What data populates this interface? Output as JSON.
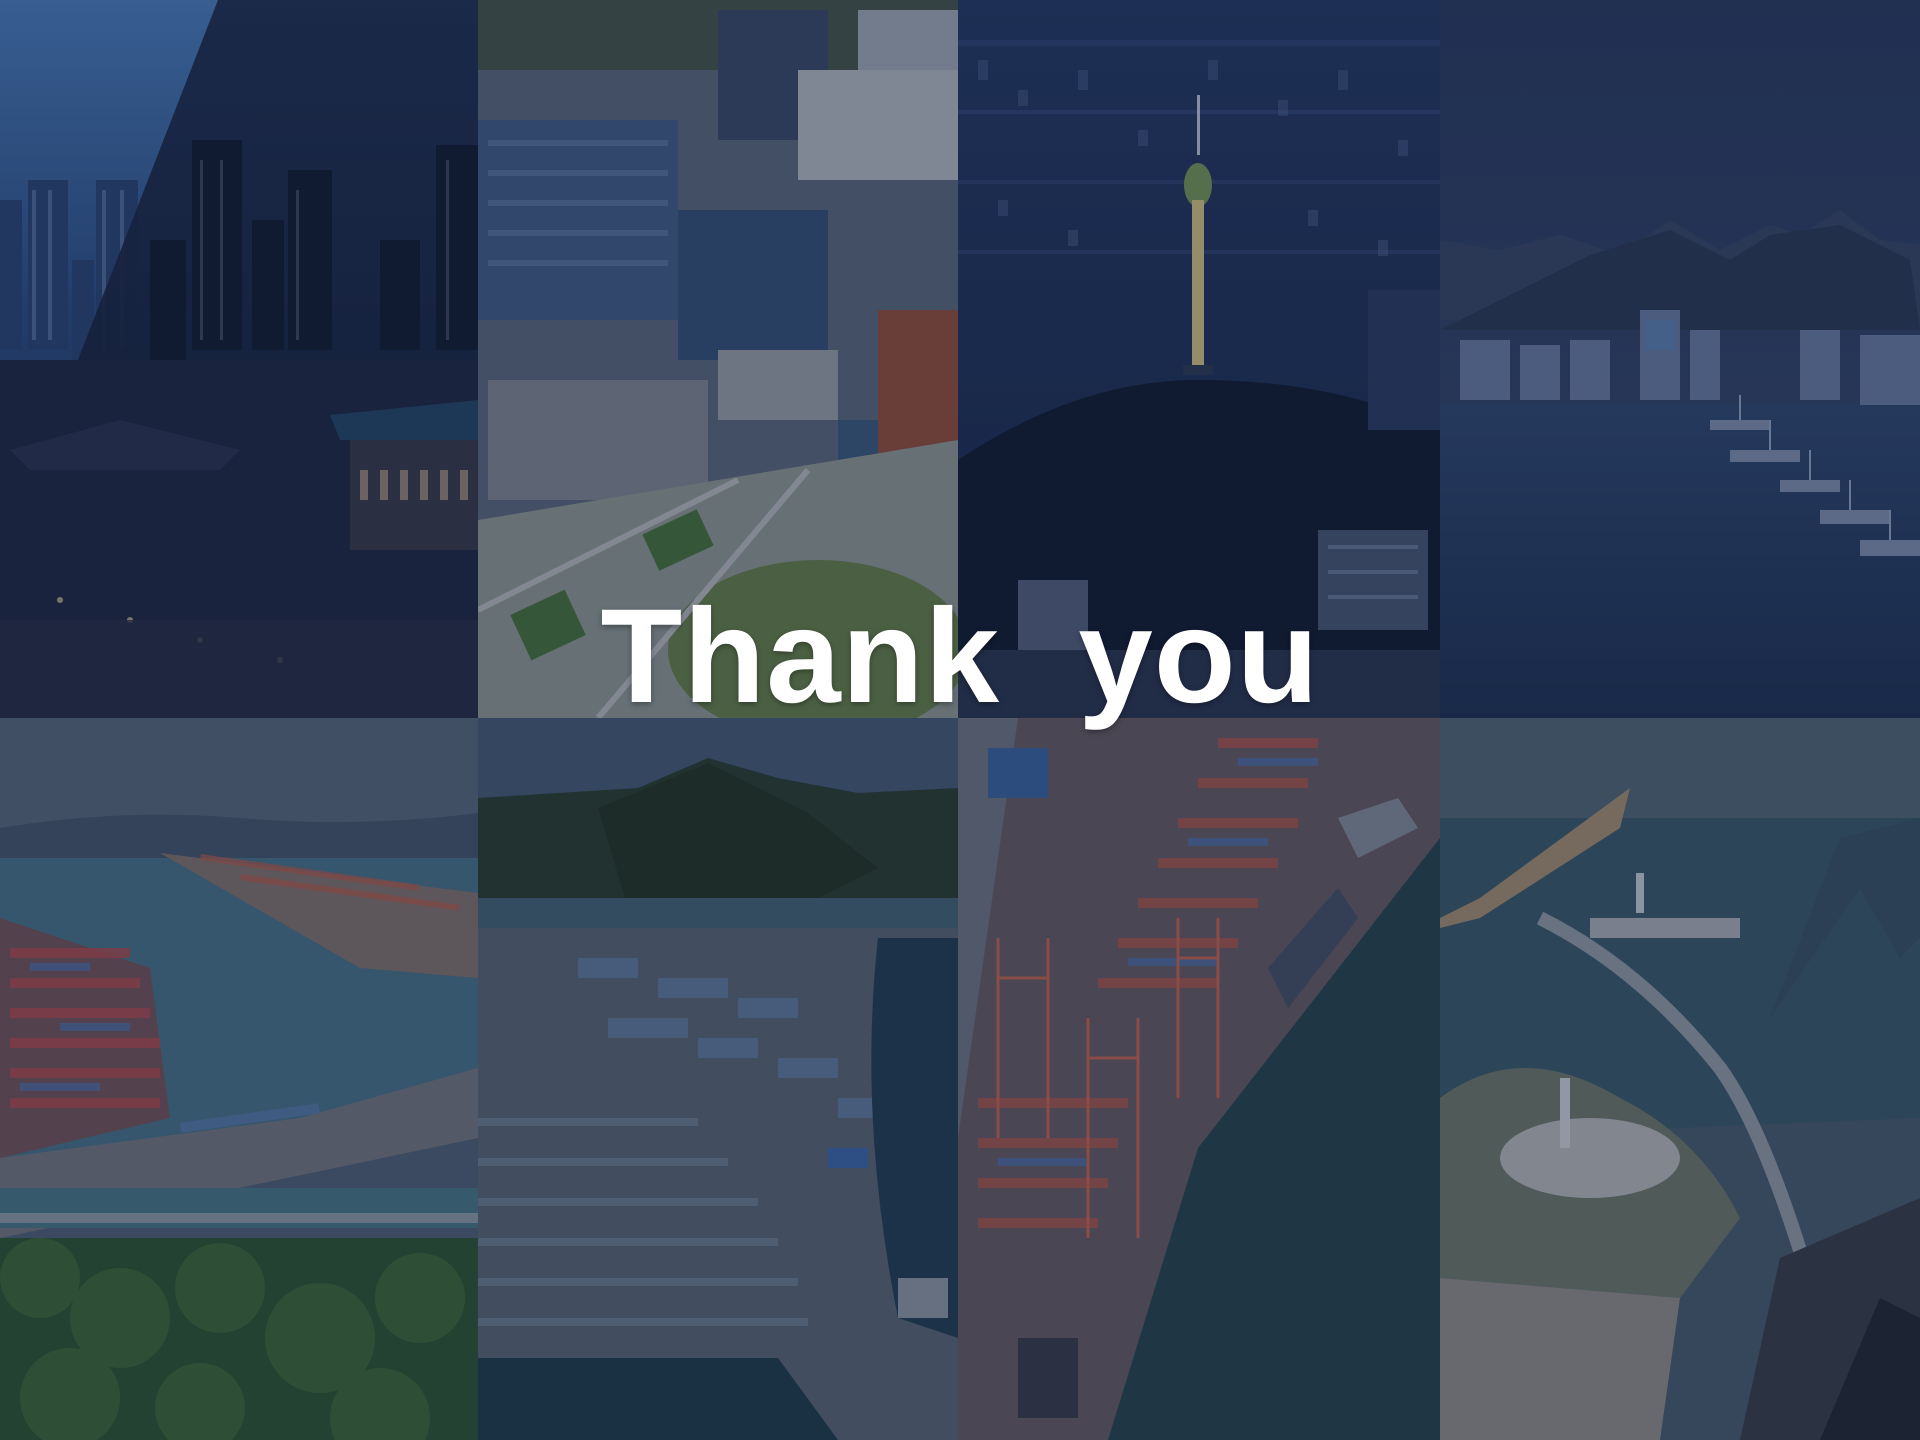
{
  "slide": {
    "title": "Thank  you"
  },
  "tiles": [
    {
      "id": "tile-city-night-skyline",
      "icon": "city-skyline-photo"
    },
    {
      "id": "tile-office-campus",
      "icon": "office-campus-photo"
    },
    {
      "id": "tile-tower-night-view",
      "icon": "tower-photo"
    },
    {
      "id": "tile-harbor-mountains",
      "icon": "harbor-photo"
    },
    {
      "id": "tile-container-port-bay",
      "icon": "container-port-photo"
    },
    {
      "id": "tile-industrial-port-aerial",
      "icon": "industrial-port-photo"
    },
    {
      "id": "tile-container-terminal",
      "icon": "container-terminal-photo"
    },
    {
      "id": "tile-breakwater-lighthouse",
      "icon": "lighthouse-photo"
    }
  ],
  "colors": {
    "overlay": "#121e3a",
    "title": "#ffffff",
    "night_sky": "#0e1a34",
    "water": "#1f3a5a"
  }
}
